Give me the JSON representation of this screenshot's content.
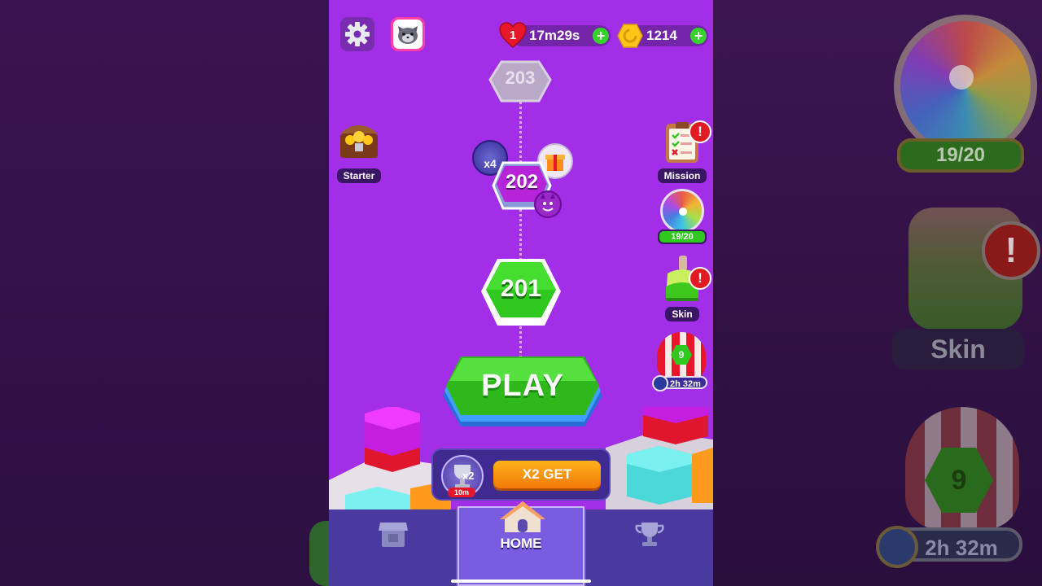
{
  "header": {
    "lives_count": "1",
    "lives_timer": "17m29s",
    "coins": "1214",
    "plus_symbol": "+"
  },
  "levels": {
    "next_next": "203",
    "next": "202",
    "current": "201",
    "trophy_multiplier": "x4"
  },
  "left_menu": {
    "starter_label": "Starter"
  },
  "right_menu": {
    "mission_label": "Mission",
    "wheel_progress": "19/20",
    "skin_label": "Skin",
    "balloon_level": "9",
    "balloon_timer": "2h 32m",
    "alert_symbol": "!"
  },
  "play_button": {
    "label": "PLAY"
  },
  "boost": {
    "multiplier": "x2",
    "timer": "10m",
    "button_label": "X2 GET"
  },
  "bottom_nav": {
    "home_label": "HOME"
  },
  "side_panel": {
    "wheel_progress": "19/20",
    "skin_label": "Skin",
    "balloon_level": "9",
    "balloon_timer": "2h 32m"
  },
  "colors": {
    "background": "#a22ee8",
    "play_green": "#3fd42c",
    "coin_gold": "#ffc61a",
    "alert_red": "#e01b24",
    "nav_bg": "#4a3aa0"
  }
}
